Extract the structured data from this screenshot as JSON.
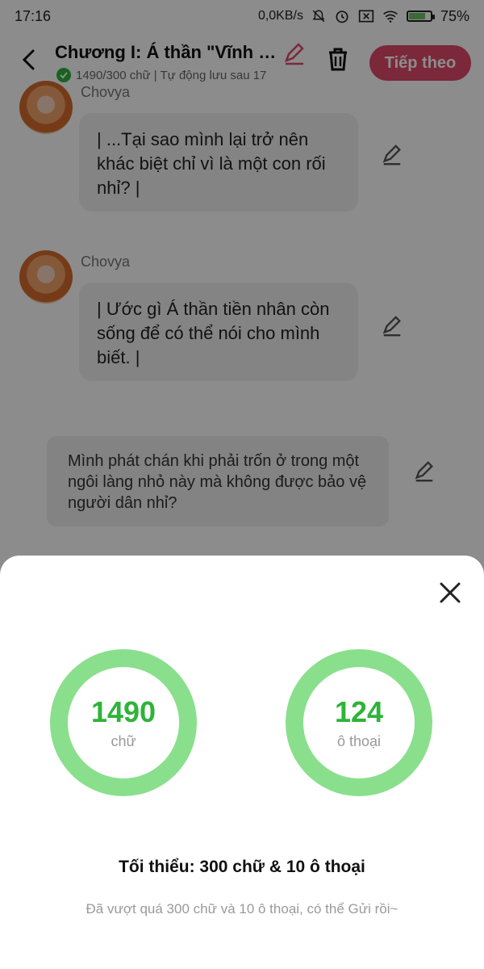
{
  "status_bar": {
    "time": "17:16",
    "net_speed": "0,0KB/s",
    "battery": "75%",
    "icons": [
      "mute-icon",
      "alarm-icon",
      "sim-icon",
      "wifi-icon",
      "battery-icon"
    ]
  },
  "header": {
    "title": "Chương I: Á thần \"Vĩnh h...",
    "subtitle": "1490/300 chữ | Tự động lưu sau 17",
    "next_label": "Tiếp theo"
  },
  "messages": [
    {
      "author": "Chovya",
      "text": "| ...Tại sao mình lại trở nên khác biệt chỉ vì là một con rối nhỉ? |"
    },
    {
      "author": "Chovya",
      "text": "| Ước gì Á thần tiền nhân còn sống để có thể nói cho mình biết. |"
    }
  ],
  "narration": {
    "text": "Mình phát chán khi phải trốn ở trong một ngôi làng nhỏ này mà không được bảo vệ người dân nhỉ?"
  },
  "sheet": {
    "words": {
      "value": "1490",
      "label": "chữ"
    },
    "dialogues": {
      "value": "124",
      "label": "ô thoại"
    },
    "minimum": "Tối thiểu: 300 chữ & 10 ô thoại",
    "hint": "Đã vượt quá 300 chữ và 10 ô thoại, có thể Gửi rồi~"
  },
  "colors": {
    "accent": "#e04a6b",
    "ring": "#8adf8d",
    "ring_text": "#2fb33a"
  }
}
